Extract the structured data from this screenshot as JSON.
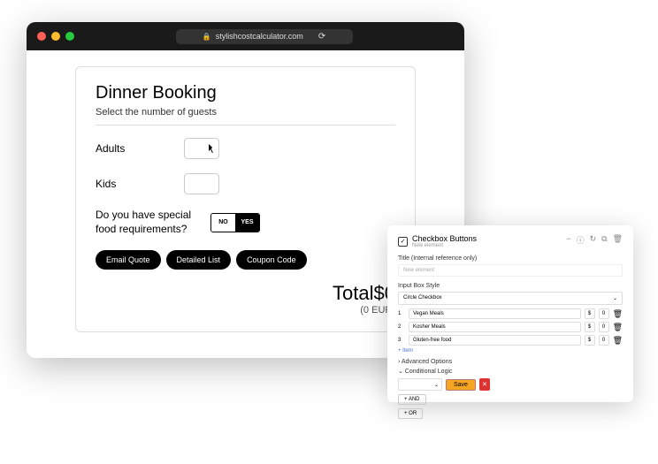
{
  "browser": {
    "url": "stylishcostcalculator.com"
  },
  "calculator": {
    "title": "Dinner Booking",
    "subtitle": "Select the number of guests",
    "field_adults": "Adults",
    "field_kids": "Kids",
    "field_special": "Do you have special food requirements?",
    "toggle_no": "NO",
    "toggle_yes": "YES",
    "btn_quote": "Email Quote",
    "btn_list": "Detailed List",
    "btn_coupon": "Coupon Code",
    "total_label": "Total",
    "total_amount": "$0",
    "sub_total": "(0 EUR)"
  },
  "panel": {
    "title": "Checkbox Buttons",
    "subtitle": "New element",
    "title_field_label": "Title (Internal reference only)",
    "title_field_value": "New element",
    "style_label": "Input Box Style",
    "style_value": "Circle Checkbox",
    "options": [
      {
        "idx": "1",
        "name": "Vegan Meals",
        "cur": "$",
        "val": "0"
      },
      {
        "idx": "2",
        "name": "Kosher Meals",
        "cur": "$",
        "val": "0"
      },
      {
        "idx": "3",
        "name": "Gluten-free food",
        "cur": "$",
        "val": "0"
      }
    ],
    "add_item": "+ Item",
    "adv_options": "› Advanced Options",
    "cond_logic": "⌄ Conditional Logic",
    "btn_save": "Save",
    "btn_and": "+ AND",
    "btn_or": "+ OR"
  }
}
